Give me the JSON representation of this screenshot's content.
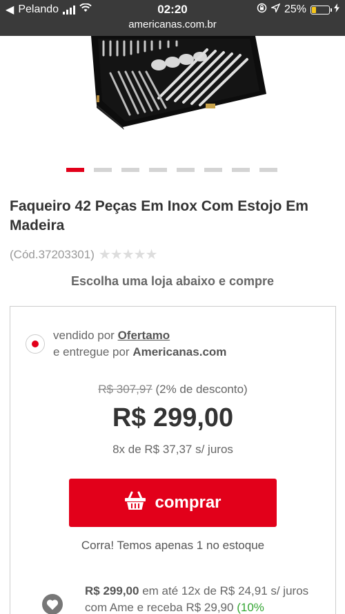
{
  "status_bar": {
    "carrier": "Pelando",
    "time": "02:20",
    "battery": "25%"
  },
  "url": "americanas.com.br",
  "carousel": {
    "count": 8,
    "active_index": 0
  },
  "product": {
    "title": "Faqueiro 42 Peças Em Inox Com Estojo Em Madeira",
    "code": "(Cód.37203301)",
    "rating_stars": "★★★★★"
  },
  "choose_store": "Escolha uma loja abaixo e compre",
  "offer": {
    "sold_by_prefix": "vendido por",
    "seller": "Ofertamo",
    "delivered_by_prefix": "e entregue por",
    "delivered_by": "Americanas.com",
    "old_price": "R$ 307,97",
    "discount": "(2% de desconto)",
    "price": "R$ 299,00",
    "installments": "8x de R$ 37,37 s/ juros",
    "buy_label": "comprar",
    "stock_note": "Corra! Temos apenas 1 no estoque"
  },
  "ame": {
    "price": "R$ 299,00",
    "text": "em até 12x de R$ 24,91 s/ juros com Ame e receba R$ 29,90",
    "highlight": "(10%"
  },
  "colors": {
    "brand_red": "#e2001a",
    "status_bar_bg": "#3a3a3a",
    "battery_yellow": "#f5c518",
    "ame_green": "#33a532"
  }
}
